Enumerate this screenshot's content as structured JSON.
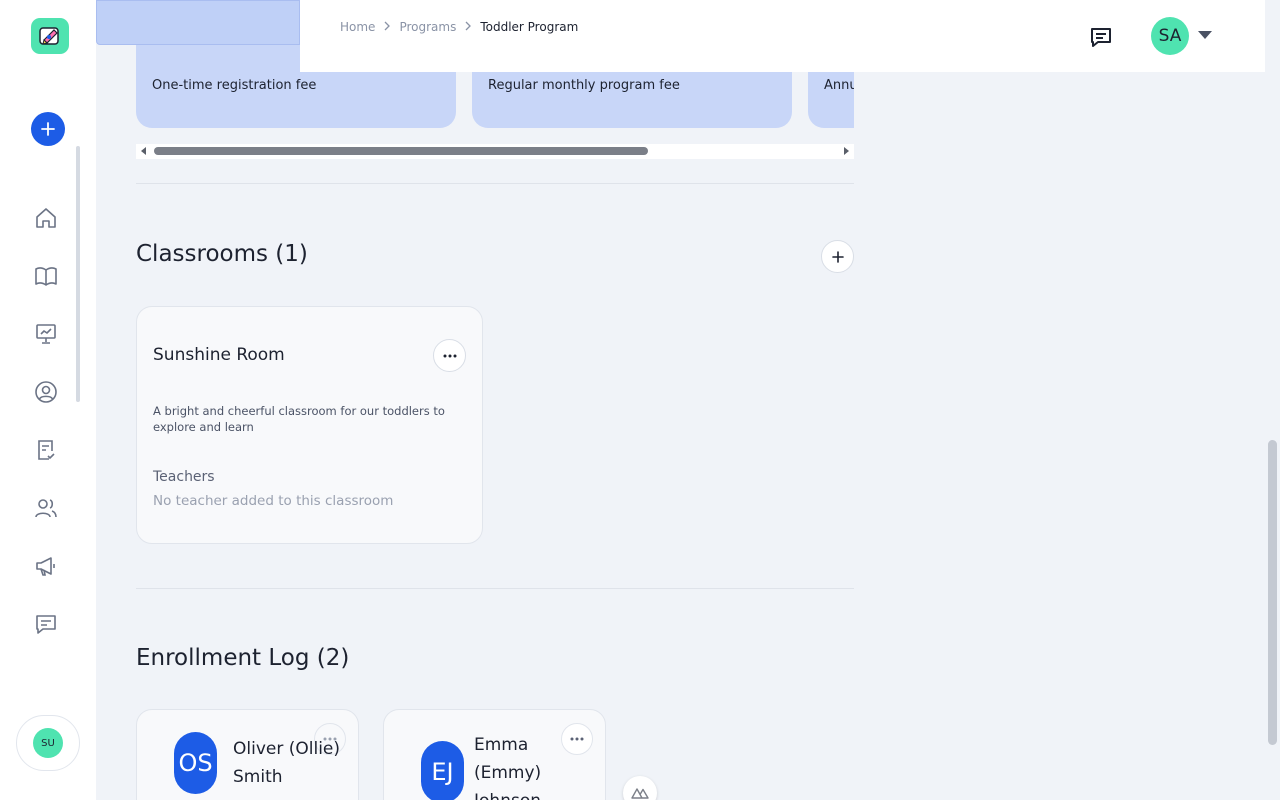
{
  "breadcrumb": {
    "home": "Home",
    "programs": "Programs",
    "current": "Toddler Program"
  },
  "header": {
    "avatar_initials": "SA"
  },
  "sidebar": {
    "user_initials": "SU",
    "nav": [
      "home-icon",
      "book-icon",
      "presentation-chart-icon",
      "user-circle-icon",
      "clipboard-check-icon",
      "users-icon",
      "megaphone-icon",
      "chat-icon"
    ]
  },
  "fees": [
    {
      "desc": "One-time registration fee"
    },
    {
      "desc": "Regular monthly program fee"
    },
    {
      "desc": "Annu"
    }
  ],
  "classrooms": {
    "title": "Classrooms (1)",
    "items": [
      {
        "name": "Sunshine Room",
        "description": "A bright and cheerful classroom for our toddlers to explore and learn",
        "teachers_label": "Teachers",
        "teachers_empty": "No teacher added to this classroom"
      }
    ]
  },
  "enrollment": {
    "title": "Enrollment Log (2)",
    "items": [
      {
        "initials": "OS",
        "name": "Oliver (Ollie) Smith"
      },
      {
        "initials": "EJ",
        "name": "Emma (Emmy) Johnson"
      }
    ]
  },
  "colors": {
    "accent": "#1d5ce6",
    "mint": "#4fe3b0",
    "fee_card": "#c8d6f8"
  }
}
